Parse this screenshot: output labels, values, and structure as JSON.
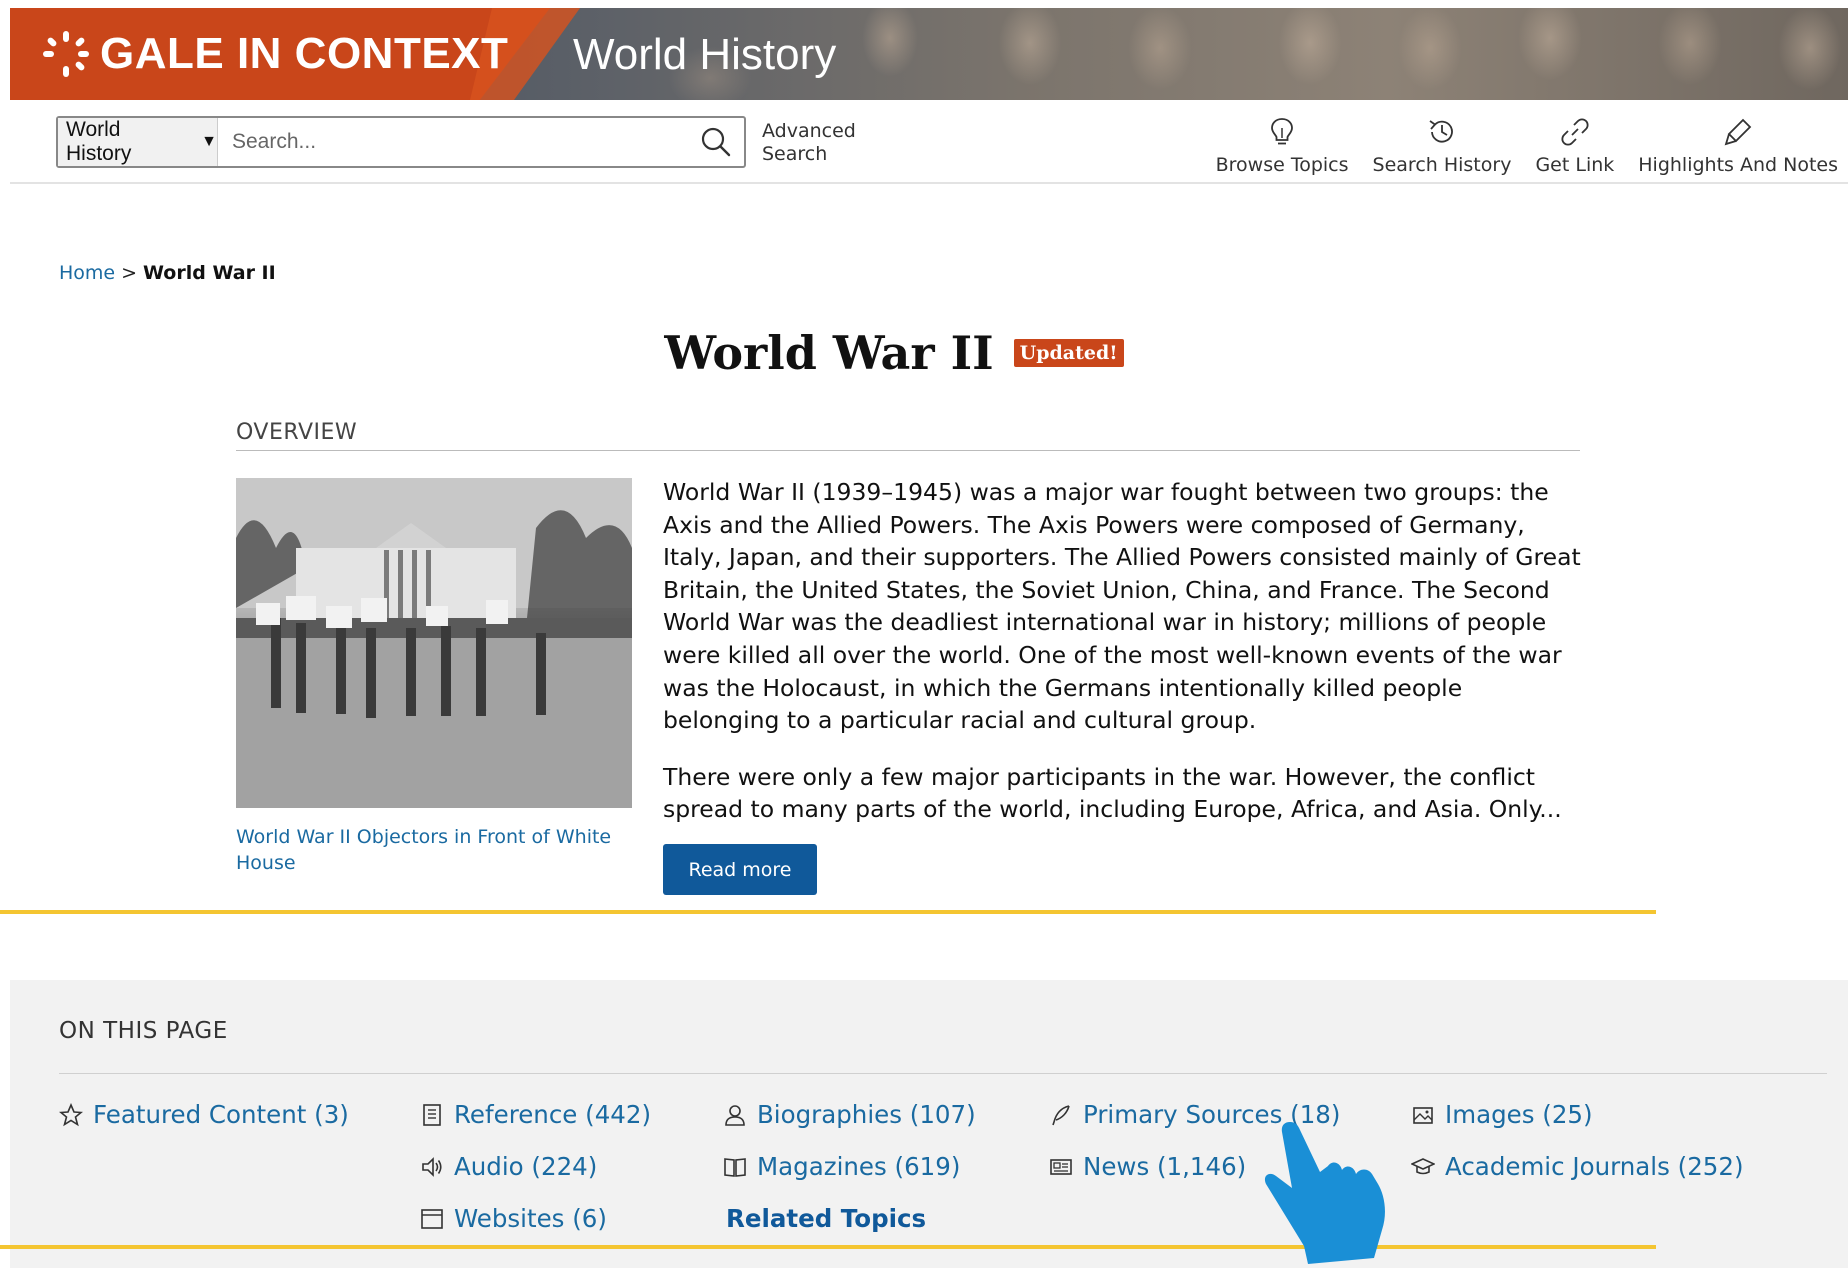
{
  "brand": {
    "name": "GALE IN CONTEXT",
    "product": "World History"
  },
  "search": {
    "scope": "World History",
    "placeholder": "Search...",
    "advanced": "Advanced Search"
  },
  "tools": [
    {
      "label": "Browse Topics",
      "icon": "lightbulb-icon"
    },
    {
      "label": "Search History",
      "icon": "history-icon"
    },
    {
      "label": "Get Link",
      "icon": "link-icon"
    },
    {
      "label": "Highlights And Notes",
      "icon": "highlighter-icon"
    }
  ],
  "breadcrumb": {
    "home": "Home",
    "separator": ">",
    "current": "World War II"
  },
  "page": {
    "title": "World War II",
    "badge": "Updated!",
    "overview_label": "OVERVIEW",
    "image_caption": "World War II Objectors in Front of White House",
    "paragraphs": [
      "World War II (1939–1945) was a major war fought between two groups: the Axis and the Allied Powers. The Axis Powers were composed of Germany, Italy, Japan, and their supporters. The Allied Powers consisted mainly of Great Britain, the United States, the Soviet Union, China, and France. The Second World War was the deadliest international war in history; millions of people were killed all over the world. One of the most well-known events of the war was the Holocaust, in which the Germans intentionally killed people belonging to a particular racial and cultural group.",
      "There were only a few major participants in the war. However, the conflict spread to many parts of the world, including Europe, Africa, and Asia. Only..."
    ],
    "read_more": "Read more"
  },
  "on_this_page": {
    "label": "ON THIS PAGE",
    "links": {
      "featured": "Featured Content (3)",
      "reference": "Reference (442)",
      "biographies": "Biographies (107)",
      "primary_sources": "Primary Sources (18)",
      "images": "Images (25)",
      "audio": "Audio (224)",
      "magazines": "Magazines (619)",
      "news": "News (1,146)",
      "academic_journals": "Academic Journals (252)",
      "websites": "Websites (6)",
      "related_topics": "Related Topics"
    }
  },
  "colors": {
    "brand_orange": "#c9461a",
    "link_blue": "#1a6aa1",
    "button_blue": "#10599a",
    "highlight_gold": "#f4c531",
    "cursor_blue": "#1a8fd6"
  }
}
